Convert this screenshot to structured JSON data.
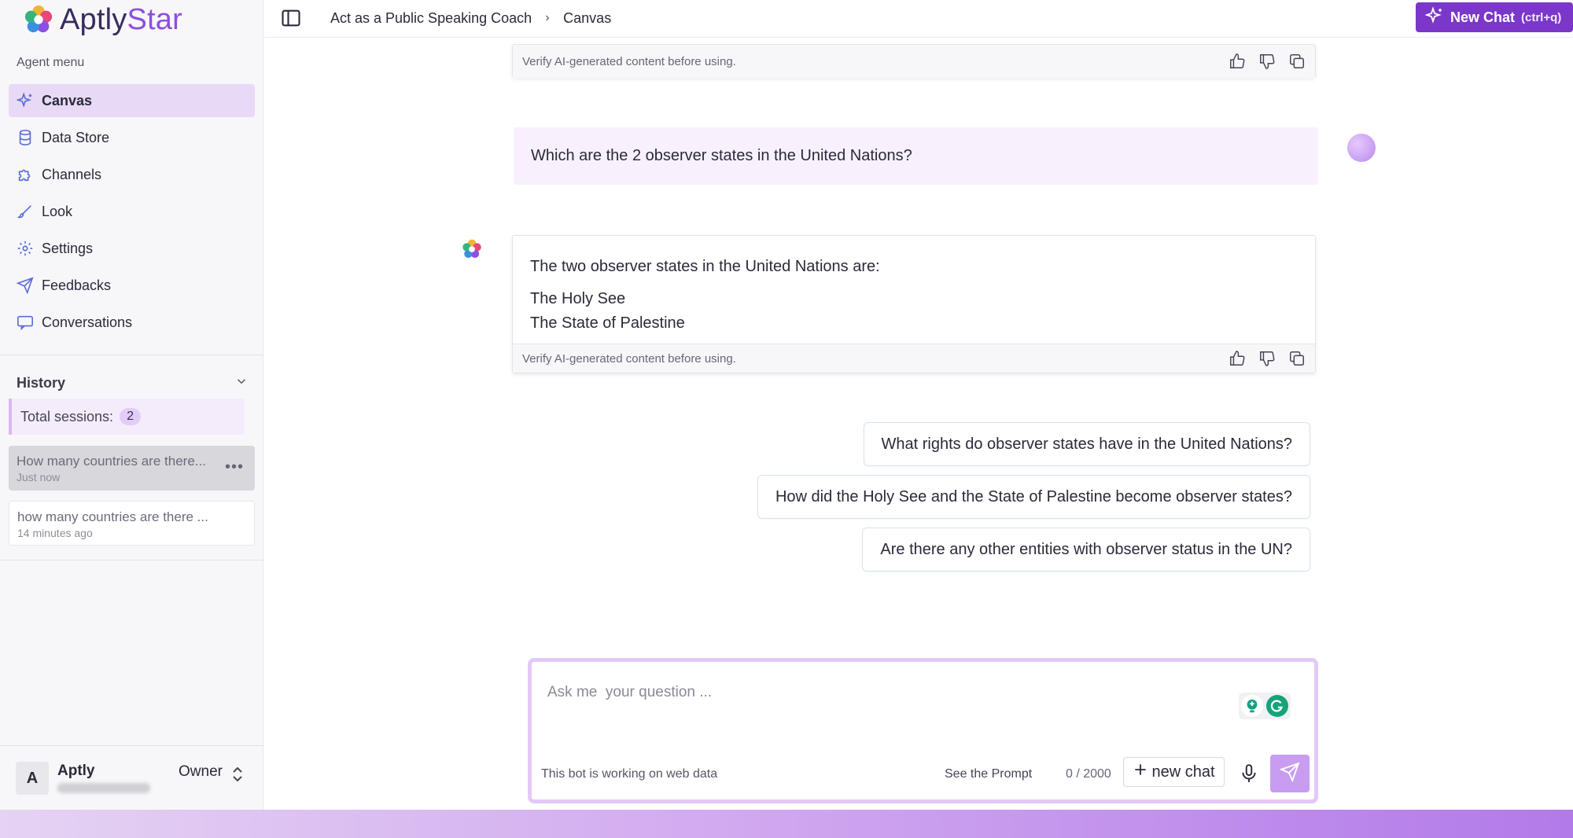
{
  "brand": {
    "name_part1": "Aptly",
    "name_part2": "Star"
  },
  "sidebar": {
    "section_label": "Agent menu",
    "items": [
      {
        "label": "Canvas",
        "icon": "sparkle-icon",
        "active": true
      },
      {
        "label": "Data Store",
        "icon": "database-icon"
      },
      {
        "label": "Channels",
        "icon": "puzzle-icon"
      },
      {
        "label": "Look",
        "icon": "brush-icon"
      },
      {
        "label": "Settings",
        "icon": "gear-icon"
      },
      {
        "label": "Feedbacks",
        "icon": "send-icon"
      },
      {
        "label": "Conversations",
        "icon": "chat-icon"
      }
    ],
    "history": {
      "title": "History",
      "sessions_label": "Total sessions:",
      "sessions_count": "2",
      "items": [
        {
          "title": "How many countries are there...",
          "time": "Just now"
        },
        {
          "title": "how many countries are there ...",
          "time": "14 minutes ago"
        }
      ]
    },
    "user": {
      "initial": "A",
      "name": "Aptly",
      "role": "Owner"
    }
  },
  "header": {
    "breadcrumb": [
      "Act as a Public Speaking Coach",
      "Canvas"
    ],
    "new_chat_label": "New Chat",
    "new_chat_shortcut": "(ctrl+q)"
  },
  "chat": {
    "verify_note": "Verify AI-generated content before using.",
    "user_question": "Which are the 2 observer states in the United Nations?",
    "answer_lead": "The two observer states in the United Nations are:",
    "answer_items": [
      "The Holy See",
      "The State of Palestine"
    ],
    "suggestions": [
      "What rights do observer states have in the United Nations?",
      "How did the Holy See and the State of Palestine become observer states?",
      "Are there any other entities with observer status in the UN?"
    ]
  },
  "composer": {
    "placeholder": "Ask me  your question ...",
    "bot_note": "This bot is working on web data",
    "see_prompt": "See the Prompt",
    "counter": "0 / 2000",
    "new_chat": "new chat"
  },
  "colors": {
    "accent": "#7a37c9",
    "active_bg": "#e8d9f7",
    "send_bg": "#c89cf0"
  }
}
